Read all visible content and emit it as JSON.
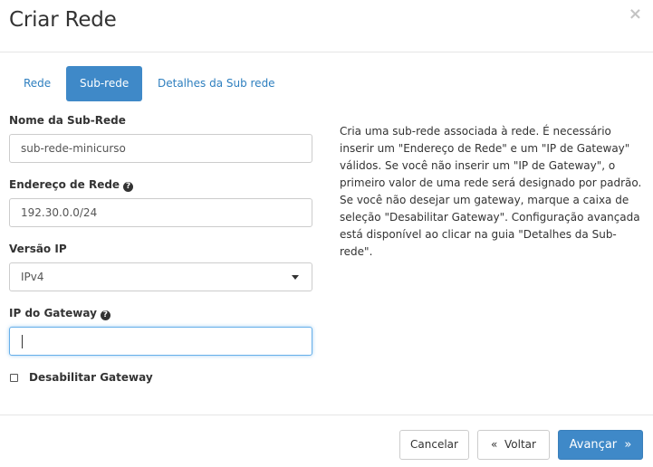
{
  "modal": {
    "title": "Criar Rede",
    "close_glyph": "×"
  },
  "tabs": [
    {
      "label": "Rede",
      "active": false
    },
    {
      "label": "Sub-rede",
      "active": true
    },
    {
      "label": "Detalhes da Sub rede",
      "active": false
    }
  ],
  "form": {
    "subnet_name": {
      "label": "Nome da Sub-Rede",
      "value": "sub-rede-minicurso"
    },
    "network_address": {
      "label": "Endereço de Rede",
      "value": "192.30.0.0/24",
      "help_icon": "question-circle-icon"
    },
    "ip_version": {
      "label": "Versão IP",
      "selected": "IPv4"
    },
    "gateway_ip": {
      "label": "IP do Gateway",
      "value": "",
      "help_icon": "question-circle-icon"
    },
    "disable_gateway": {
      "label": "Desabilitar Gateway",
      "checked": false
    }
  },
  "help_text": "Cria uma sub-rede associada à rede. É necessário inserir um \"Endereço de Rede\" e um \"IP de Gateway\" válidos. Se você não inserir um \"IP de Gateway\", o primeiro valor de uma rede será designado por padrão. Se você não desejar um gateway, marque a caixa de seleção \"Desabilitar Gateway\". Configuração avançada está disponível ao clicar na guia \"Detalhes da Sub-rede\".",
  "footer": {
    "cancel_label": "Cancelar",
    "back_label": "«  Voltar",
    "next_label": "Avançar  »"
  },
  "colors": {
    "primary": "#3f89c8",
    "link": "#2e7fbf",
    "focus_border": "#66afe9"
  }
}
